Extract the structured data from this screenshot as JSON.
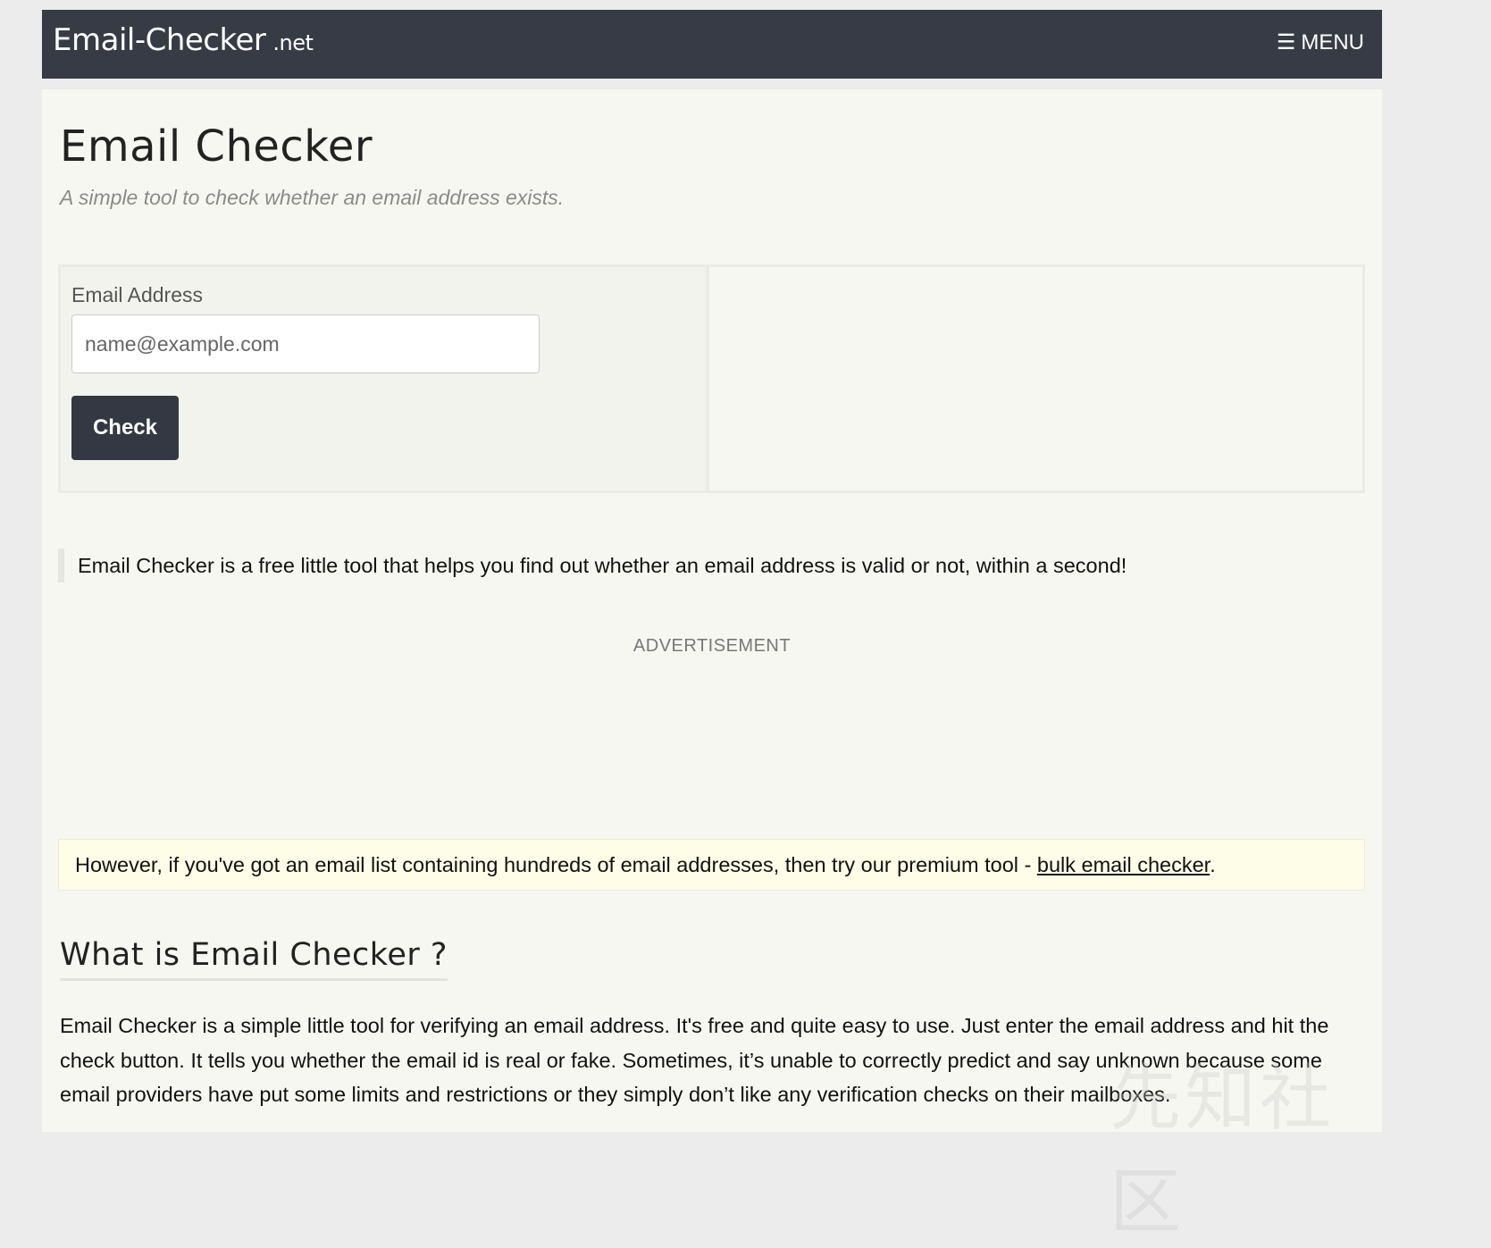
{
  "navbar": {
    "brand_name": "Email-Checker",
    "brand_tld": ".net",
    "menu_icon": "☰",
    "menu_label": "MENU"
  },
  "header": {
    "title": "Email Checker",
    "subtitle": "A simple tool to check whether an email address exists."
  },
  "form": {
    "email_label": "Email Address",
    "email_placeholder": "name@example.com",
    "email_value": "",
    "check_label": "Check"
  },
  "intro": {
    "text": "Email Checker is a free little tool that helps you find out whether an email address is valid or not, within a second!"
  },
  "advertisement": {
    "label": "ADVERTISEMENT"
  },
  "premium": {
    "text_before": "However, if you've got an email list containing hundreds of email addresses, then try our premium tool - ",
    "link_text": "bulk email checker",
    "text_after": "."
  },
  "what_is": {
    "heading": "What is Email Checker ?",
    "body": "Email Checker is a simple little tool for verifying an email address. It's free and quite easy to use. Just enter the email address and hit the check button. It tells you whether the email id is real or fake. Sometimes, it’s unable to correctly predict and say unknown because some email providers have put some limits and restrictions or they simply don’t like any verification checks on their mailboxes."
  },
  "watermark": {
    "text": "先知社区"
  },
  "colors": {
    "navbar_bg": "#373b45",
    "button_bg": "#343842",
    "page_bg": "#f7f7f2",
    "premium_bg": "#fdfde8"
  }
}
